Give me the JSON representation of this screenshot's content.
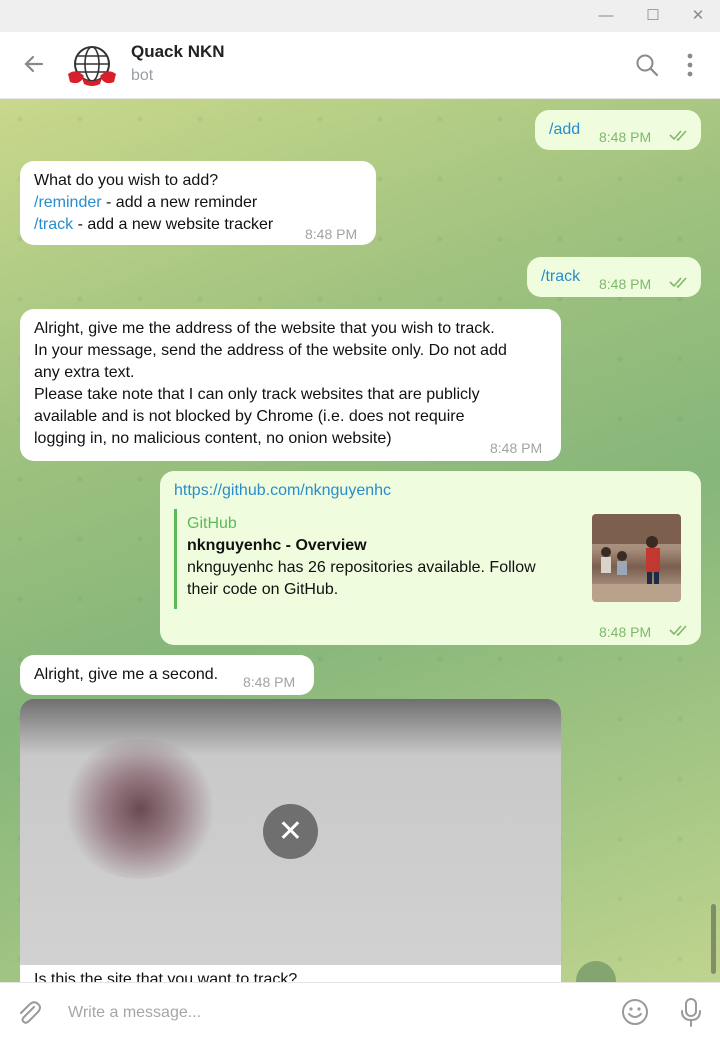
{
  "window": {
    "minimize": "—",
    "maximize": "☐",
    "close": "✕"
  },
  "header": {
    "name": "Quack NKN",
    "status": "bot"
  },
  "messages": {
    "m1": {
      "text": "/add",
      "time": "8:48 PM"
    },
    "m2": {
      "line1": "What do you wish to add?",
      "cmd1": "/reminder",
      "desc1": " - add a new reminder",
      "cmd2": "/track",
      "desc2": " - add a new website tracker",
      "time": "8:48 PM"
    },
    "m3": {
      "text": "/track",
      "time": "8:48 PM"
    },
    "m4": {
      "l1": "Alright, give me the address of the website that you wish to track.",
      "l2": "In your message, send the address of the website only. Do not add",
      "l3": "any extra text.",
      "l4": "Please take note that I can only track websites that are publicly",
      "l5": "available and is not blocked by Chrome (i.e. does not require",
      "l6": "logging in, no malicious content, no onion website)",
      "time": "8:48 PM"
    },
    "m5": {
      "url": "https://github.com/nknguyenhc",
      "site": "GitHub",
      "title": "nknguyenhc - Overview",
      "desc1": "nknguyenhc has 26 repositories available. Follow",
      "desc2": "their code on GitHub.",
      "time": "8:48 PM"
    },
    "m6": {
      "text": "Alright, give me a second.",
      "time": "8:48 PM"
    },
    "m7": {
      "caption": "Is this the site that you want to track?"
    }
  },
  "composer": {
    "placeholder": "Write a message..."
  },
  "colors": {
    "accent": "#2a8ccb",
    "outgoing_bubble": "#effdde",
    "preview_bar": "#5fb85a"
  }
}
